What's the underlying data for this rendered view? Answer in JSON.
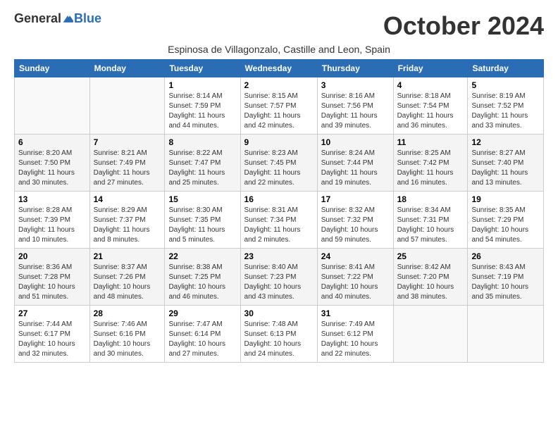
{
  "header": {
    "logo_general": "General",
    "logo_blue": "Blue",
    "month_title": "October 2024",
    "subtitle": "Espinosa de Villagonzalo, Castille and Leon, Spain"
  },
  "days_of_week": [
    "Sunday",
    "Monday",
    "Tuesday",
    "Wednesday",
    "Thursday",
    "Friday",
    "Saturday"
  ],
  "weeks": [
    [
      {
        "day": "",
        "info": ""
      },
      {
        "day": "",
        "info": ""
      },
      {
        "day": "1",
        "info": "Sunrise: 8:14 AM\nSunset: 7:59 PM\nDaylight: 11 hours and 44 minutes."
      },
      {
        "day": "2",
        "info": "Sunrise: 8:15 AM\nSunset: 7:57 PM\nDaylight: 11 hours and 42 minutes."
      },
      {
        "day": "3",
        "info": "Sunrise: 8:16 AM\nSunset: 7:56 PM\nDaylight: 11 hours and 39 minutes."
      },
      {
        "day": "4",
        "info": "Sunrise: 8:18 AM\nSunset: 7:54 PM\nDaylight: 11 hours and 36 minutes."
      },
      {
        "day": "5",
        "info": "Sunrise: 8:19 AM\nSunset: 7:52 PM\nDaylight: 11 hours and 33 minutes."
      }
    ],
    [
      {
        "day": "6",
        "info": "Sunrise: 8:20 AM\nSunset: 7:50 PM\nDaylight: 11 hours and 30 minutes."
      },
      {
        "day": "7",
        "info": "Sunrise: 8:21 AM\nSunset: 7:49 PM\nDaylight: 11 hours and 27 minutes."
      },
      {
        "day": "8",
        "info": "Sunrise: 8:22 AM\nSunset: 7:47 PM\nDaylight: 11 hours and 25 minutes."
      },
      {
        "day": "9",
        "info": "Sunrise: 8:23 AM\nSunset: 7:45 PM\nDaylight: 11 hours and 22 minutes."
      },
      {
        "day": "10",
        "info": "Sunrise: 8:24 AM\nSunset: 7:44 PM\nDaylight: 11 hours and 19 minutes."
      },
      {
        "day": "11",
        "info": "Sunrise: 8:25 AM\nSunset: 7:42 PM\nDaylight: 11 hours and 16 minutes."
      },
      {
        "day": "12",
        "info": "Sunrise: 8:27 AM\nSunset: 7:40 PM\nDaylight: 11 hours and 13 minutes."
      }
    ],
    [
      {
        "day": "13",
        "info": "Sunrise: 8:28 AM\nSunset: 7:39 PM\nDaylight: 11 hours and 10 minutes."
      },
      {
        "day": "14",
        "info": "Sunrise: 8:29 AM\nSunset: 7:37 PM\nDaylight: 11 hours and 8 minutes."
      },
      {
        "day": "15",
        "info": "Sunrise: 8:30 AM\nSunset: 7:35 PM\nDaylight: 11 hours and 5 minutes."
      },
      {
        "day": "16",
        "info": "Sunrise: 8:31 AM\nSunset: 7:34 PM\nDaylight: 11 hours and 2 minutes."
      },
      {
        "day": "17",
        "info": "Sunrise: 8:32 AM\nSunset: 7:32 PM\nDaylight: 10 hours and 59 minutes."
      },
      {
        "day": "18",
        "info": "Sunrise: 8:34 AM\nSunset: 7:31 PM\nDaylight: 10 hours and 57 minutes."
      },
      {
        "day": "19",
        "info": "Sunrise: 8:35 AM\nSunset: 7:29 PM\nDaylight: 10 hours and 54 minutes."
      }
    ],
    [
      {
        "day": "20",
        "info": "Sunrise: 8:36 AM\nSunset: 7:28 PM\nDaylight: 10 hours and 51 minutes."
      },
      {
        "day": "21",
        "info": "Sunrise: 8:37 AM\nSunset: 7:26 PM\nDaylight: 10 hours and 48 minutes."
      },
      {
        "day": "22",
        "info": "Sunrise: 8:38 AM\nSunset: 7:25 PM\nDaylight: 10 hours and 46 minutes."
      },
      {
        "day": "23",
        "info": "Sunrise: 8:40 AM\nSunset: 7:23 PM\nDaylight: 10 hours and 43 minutes."
      },
      {
        "day": "24",
        "info": "Sunrise: 8:41 AM\nSunset: 7:22 PM\nDaylight: 10 hours and 40 minutes."
      },
      {
        "day": "25",
        "info": "Sunrise: 8:42 AM\nSunset: 7:20 PM\nDaylight: 10 hours and 38 minutes."
      },
      {
        "day": "26",
        "info": "Sunrise: 8:43 AM\nSunset: 7:19 PM\nDaylight: 10 hours and 35 minutes."
      }
    ],
    [
      {
        "day": "27",
        "info": "Sunrise: 7:44 AM\nSunset: 6:17 PM\nDaylight: 10 hours and 32 minutes."
      },
      {
        "day": "28",
        "info": "Sunrise: 7:46 AM\nSunset: 6:16 PM\nDaylight: 10 hours and 30 minutes."
      },
      {
        "day": "29",
        "info": "Sunrise: 7:47 AM\nSunset: 6:14 PM\nDaylight: 10 hours and 27 minutes."
      },
      {
        "day": "30",
        "info": "Sunrise: 7:48 AM\nSunset: 6:13 PM\nDaylight: 10 hours and 24 minutes."
      },
      {
        "day": "31",
        "info": "Sunrise: 7:49 AM\nSunset: 6:12 PM\nDaylight: 10 hours and 22 minutes."
      },
      {
        "day": "",
        "info": ""
      },
      {
        "day": "",
        "info": ""
      }
    ]
  ]
}
